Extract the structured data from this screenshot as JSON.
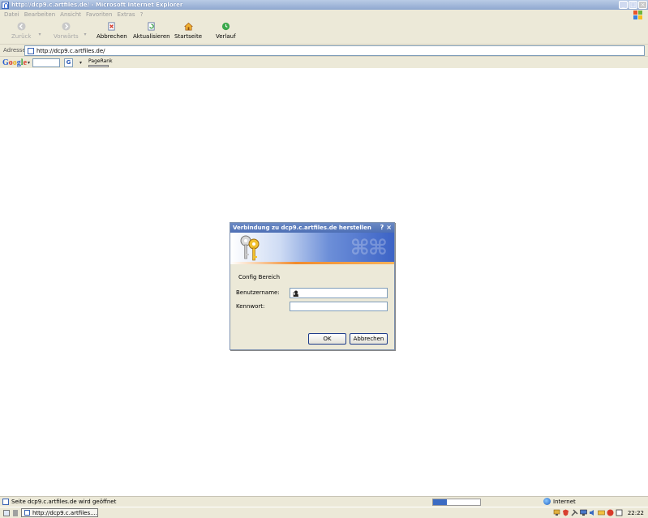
{
  "window": {
    "title": "http://dcp9.c.artfiles.de/ - Microsoft Internet Explorer",
    "minimize": "_",
    "maximize": "□",
    "close": "×"
  },
  "menu": {
    "items": [
      "Datei",
      "Bearbeiten",
      "Ansicht",
      "Favoriten",
      "Extras",
      "?"
    ]
  },
  "toolbar": {
    "back": "Zurück",
    "forward": "Vorwärts",
    "stop": "Abbrechen",
    "refresh": "Aktualisieren",
    "home": "Startseite",
    "history": "Verlauf",
    "dropdown": "▾"
  },
  "address": {
    "label": "Adresse",
    "value": "http://dcp9.c.artfiles.de/"
  },
  "googlebar": {
    "logo": "Google",
    "dropdown": "▾",
    "search_button": "G",
    "pagerank_label": "PageRank"
  },
  "dialog": {
    "title": "Verbindung zu dcp9.c.artfiles.de herstellen",
    "help": "?",
    "close": "×",
    "realm": "Config Bereich",
    "username_label": "Benutzername:",
    "username_value": "",
    "password_label": "Kennwort:",
    "password_value": "",
    "ok_label": "OK",
    "cancel_label": "Abbrechen"
  },
  "statusbar": {
    "text": "Seite dcp9.c.artfiles.de  wird geöffnet",
    "progress": 0.3,
    "zone": "Internet"
  },
  "taskbar": {
    "task_label": "http://dcp9.c.artfiles....",
    "clock": "22:22"
  },
  "colors": {
    "accent": "#3b6bc3",
    "dialog_stripe": "#f08c2e"
  }
}
